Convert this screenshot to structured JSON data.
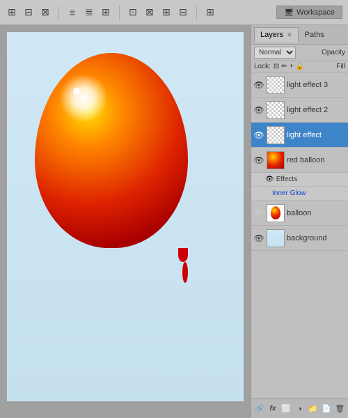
{
  "toolbar": {
    "workspace_label": "Workspace"
  },
  "canvas": {
    "label": "canvas-area"
  },
  "layers_panel": {
    "tabs": [
      {
        "label": "Layers",
        "active": true,
        "id": "layers"
      },
      {
        "label": "Paths",
        "active": false,
        "id": "paths"
      }
    ],
    "blend_mode": "Normal",
    "opacity_label": "Opacity",
    "lock_label": "Lock:",
    "fill_label": "Fill",
    "layers": [
      {
        "id": "light-effect-3",
        "name": "light effect 3",
        "visible": true,
        "selected": false,
        "thumb": "checker"
      },
      {
        "id": "light-effect-2",
        "name": "light effect 2",
        "visible": true,
        "selected": false,
        "thumb": "checker"
      },
      {
        "id": "light-effect",
        "name": "light effect",
        "visible": true,
        "selected": true,
        "thumb": "checker"
      },
      {
        "id": "red-balloon",
        "name": "red balloon",
        "visible": true,
        "selected": false,
        "thumb": "balloon"
      },
      {
        "id": "effects-group",
        "name": "Effects",
        "visible": true,
        "selected": false,
        "thumb": null,
        "indent": 1
      },
      {
        "id": "inner-glow",
        "name": "Inner Glow",
        "visible": true,
        "selected": false,
        "thumb": null,
        "indent": 2
      },
      {
        "id": "balloon",
        "name": "balloon",
        "visible": false,
        "selected": false,
        "thumb": "balloon-small"
      },
      {
        "id": "background",
        "name": "background",
        "visible": true,
        "selected": false,
        "thumb": "bg"
      }
    ],
    "bottom_icons": [
      "link",
      "fx",
      "mask",
      "adjustment",
      "folder",
      "new-layer",
      "delete"
    ]
  }
}
